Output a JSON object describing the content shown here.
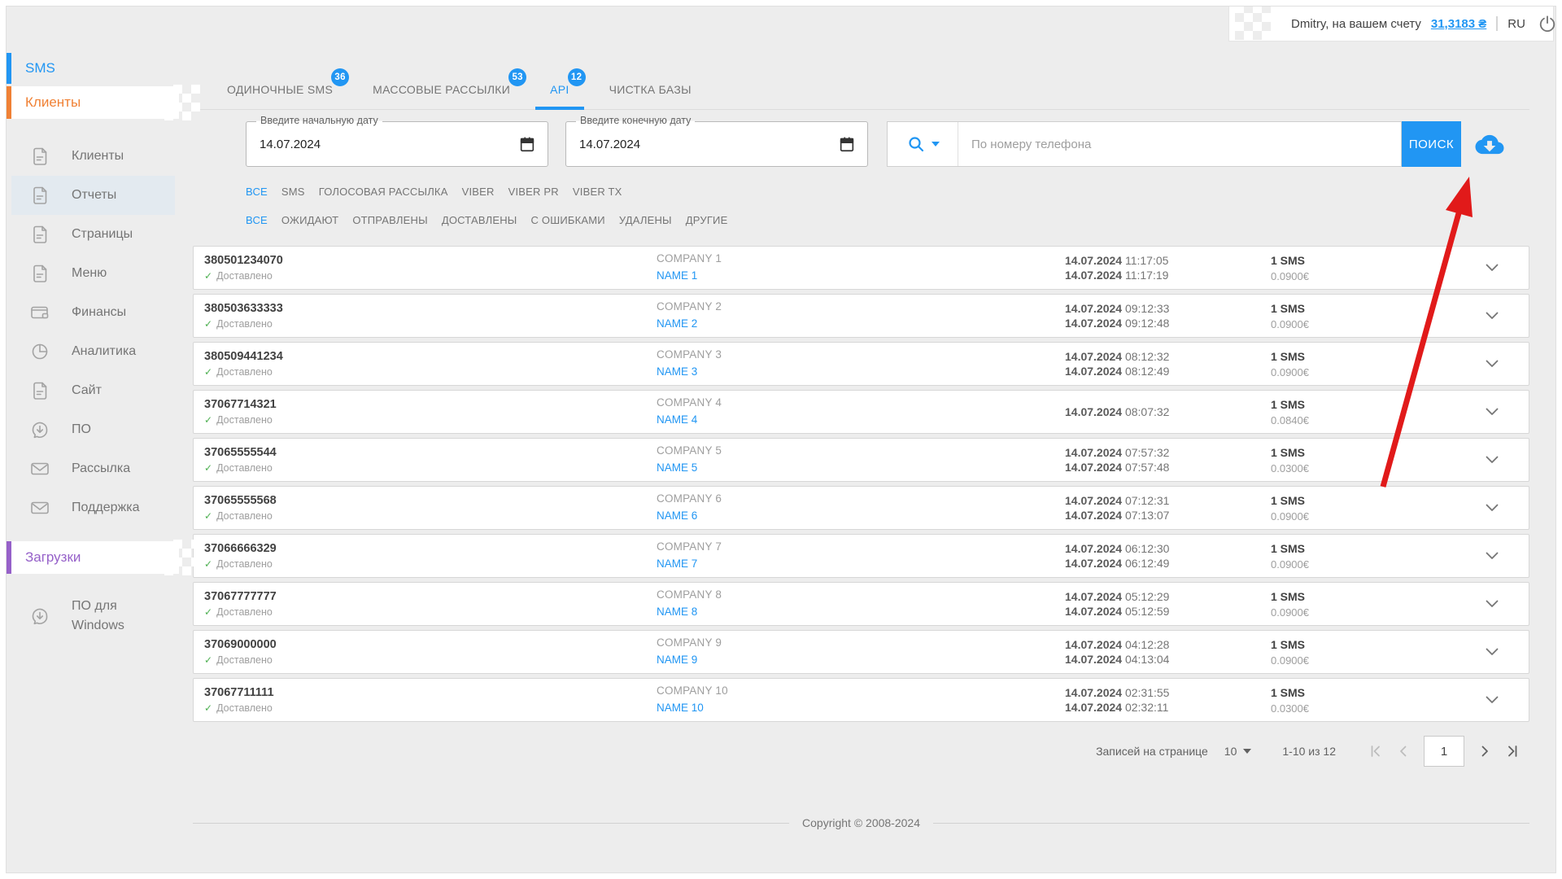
{
  "colors": {
    "accent": "#2196f3",
    "orange": "#f08135",
    "purple": "#9661c9",
    "green_check": "#4caf50",
    "arrow_red": "#e11a1a"
  },
  "topbar": {
    "user_text": "Dmitry, на вашем счету",
    "balance": "31,3183 ₴",
    "language": "RU"
  },
  "sidebar": {
    "sms_section": "SMS",
    "clients_section": "Клиенты",
    "downloads_section": "Загрузки",
    "items": [
      {
        "label": "Клиенты",
        "icon": "document-icon",
        "active": false
      },
      {
        "label": "Отчеты",
        "icon": "document-icon",
        "active": true
      },
      {
        "label": "Страницы",
        "icon": "document-icon",
        "active": false
      },
      {
        "label": "Меню",
        "icon": "document-icon",
        "active": false
      },
      {
        "label": "Финансы",
        "icon": "wallet-icon",
        "active": false
      },
      {
        "label": "Аналитика",
        "icon": "pie-chart-icon",
        "active": false
      },
      {
        "label": "Сайт",
        "icon": "document-icon",
        "active": false
      },
      {
        "label": "ПО",
        "icon": "download-bubble-icon",
        "active": false
      },
      {
        "label": "Рассылка",
        "icon": "envelope-icon",
        "active": false
      },
      {
        "label": "Поддержка",
        "icon": "envelope-icon",
        "active": false
      }
    ],
    "download_items": [
      {
        "label": "ПО для Windows",
        "icon": "download-bubble-icon",
        "active": false
      }
    ]
  },
  "tabs": [
    {
      "label": "ОДИНОЧНЫЕ SMS",
      "badge": "36",
      "active": false
    },
    {
      "label": "МАССОВЫЕ РАССЫЛКИ",
      "badge": "53",
      "active": false
    },
    {
      "label": "API",
      "badge": "12",
      "active": true
    },
    {
      "label": "ЧИСТКА БАЗЫ",
      "badge": "",
      "active": false
    }
  ],
  "filter_bar": {
    "date_from_label": "Введите начальную дату",
    "date_from_value": "14.07.2024",
    "date_to_label": "Введите конечную дату",
    "date_to_value": "14.07.2024",
    "search_placeholder": "По номеру телефона",
    "search_button": "ПОИСК"
  },
  "channel_filters": [
    {
      "label": "ВСЕ",
      "active": true
    },
    {
      "label": "SMS",
      "active": false
    },
    {
      "label": "ГОЛОСОВАЯ РАССЫЛКА",
      "active": false
    },
    {
      "label": "VIBER",
      "active": false
    },
    {
      "label": "VIBER PR",
      "active": false
    },
    {
      "label": "VIBER TX",
      "active": false
    }
  ],
  "status_filters": [
    {
      "label": "ВСЕ",
      "active": true
    },
    {
      "label": "ОЖИДАЮТ",
      "active": false
    },
    {
      "label": "ОТПРАВЛЕНЫ",
      "active": false
    },
    {
      "label": "ДОСТАВЛЕНЫ",
      "active": false
    },
    {
      "label": "С ОШИБКАМИ",
      "active": false
    },
    {
      "label": "УДАЛЕНЫ",
      "active": false
    },
    {
      "label": "ДРУГИЕ",
      "active": false
    }
  ],
  "table": {
    "rows": [
      {
        "phone": "380501234070",
        "status": "Доставлено",
        "company": "COMPANY 1",
        "name": "NAME 1",
        "date1": "14.07.2024",
        "time1": "11:17:05",
        "date2": "14.07.2024",
        "time2": "11:17:19",
        "count": "1 SMS",
        "price": "0.0900€"
      },
      {
        "phone": "380503633333",
        "status": "Доставлено",
        "company": "COMPANY 2",
        "name": "NAME 2",
        "date1": "14.07.2024",
        "time1": "09:12:33",
        "date2": "14.07.2024",
        "time2": "09:12:48",
        "count": "1 SMS",
        "price": "0.0900€"
      },
      {
        "phone": "380509441234",
        "status": "Доставлено",
        "company": "COMPANY 3",
        "name": "NAME 3",
        "date1": "14.07.2024",
        "time1": "08:12:32",
        "date2": "14.07.2024",
        "time2": "08:12:49",
        "count": "1 SMS",
        "price": "0.0900€"
      },
      {
        "phone": "37067714321",
        "status": "Доставлено",
        "company": "COMPANY 4",
        "name": "NAME 4",
        "date1": "14.07.2024",
        "time1": "08:07:32",
        "date2": "",
        "time2": "",
        "count": "1 SMS",
        "price": "0.0840€"
      },
      {
        "phone": "37065555544",
        "status": "Доставлено",
        "company": "COMPANY 5",
        "name": "NAME 5",
        "date1": "14.07.2024",
        "time1": "07:57:32",
        "date2": "14.07.2024",
        "time2": "07:57:48",
        "count": "1 SMS",
        "price": "0.0300€"
      },
      {
        "phone": "37065555568",
        "status": "Доставлено",
        "company": "COMPANY 6",
        "name": "NAME 6",
        "date1": "14.07.2024",
        "time1": "07:12:31",
        "date2": "14.07.2024",
        "time2": "07:13:07",
        "count": "1 SMS",
        "price": "0.0900€"
      },
      {
        "phone": "37066666329",
        "status": "Доставлено",
        "company": "COMPANY 7",
        "name": "NAME 7",
        "date1": "14.07.2024",
        "time1": "06:12:30",
        "date2": "14.07.2024",
        "time2": "06:12:49",
        "count": "1 SMS",
        "price": "0.0900€"
      },
      {
        "phone": "37067777777",
        "status": "Доставлено",
        "company": "COMPANY 8",
        "name": "NAME 8",
        "date1": "14.07.2024",
        "time1": "05:12:29",
        "date2": "14.07.2024",
        "time2": "05:12:59",
        "count": "1 SMS",
        "price": "0.0900€"
      },
      {
        "phone": "37069000000",
        "status": "Доставлено",
        "company": "COMPANY 9",
        "name": "NAME 9",
        "date1": "14.07.2024",
        "time1": "04:12:28",
        "date2": "14.07.2024",
        "time2": "04:13:04",
        "count": "1 SMS",
        "price": "0.0900€"
      },
      {
        "phone": "37067711111",
        "status": "Доставлено",
        "company": "COMPANY 10",
        "name": "NAME 10",
        "date1": "14.07.2024",
        "time1": "02:31:55",
        "date2": "14.07.2024",
        "time2": "02:32:11",
        "count": "1 SMS",
        "price": "0.0300€"
      }
    ]
  },
  "pagination": {
    "per_page_label": "Записей на странице",
    "per_page": "10",
    "range": "1-10 из 12",
    "page": "1"
  },
  "footer": {
    "copyright": "Copyright © 2008-2024"
  }
}
